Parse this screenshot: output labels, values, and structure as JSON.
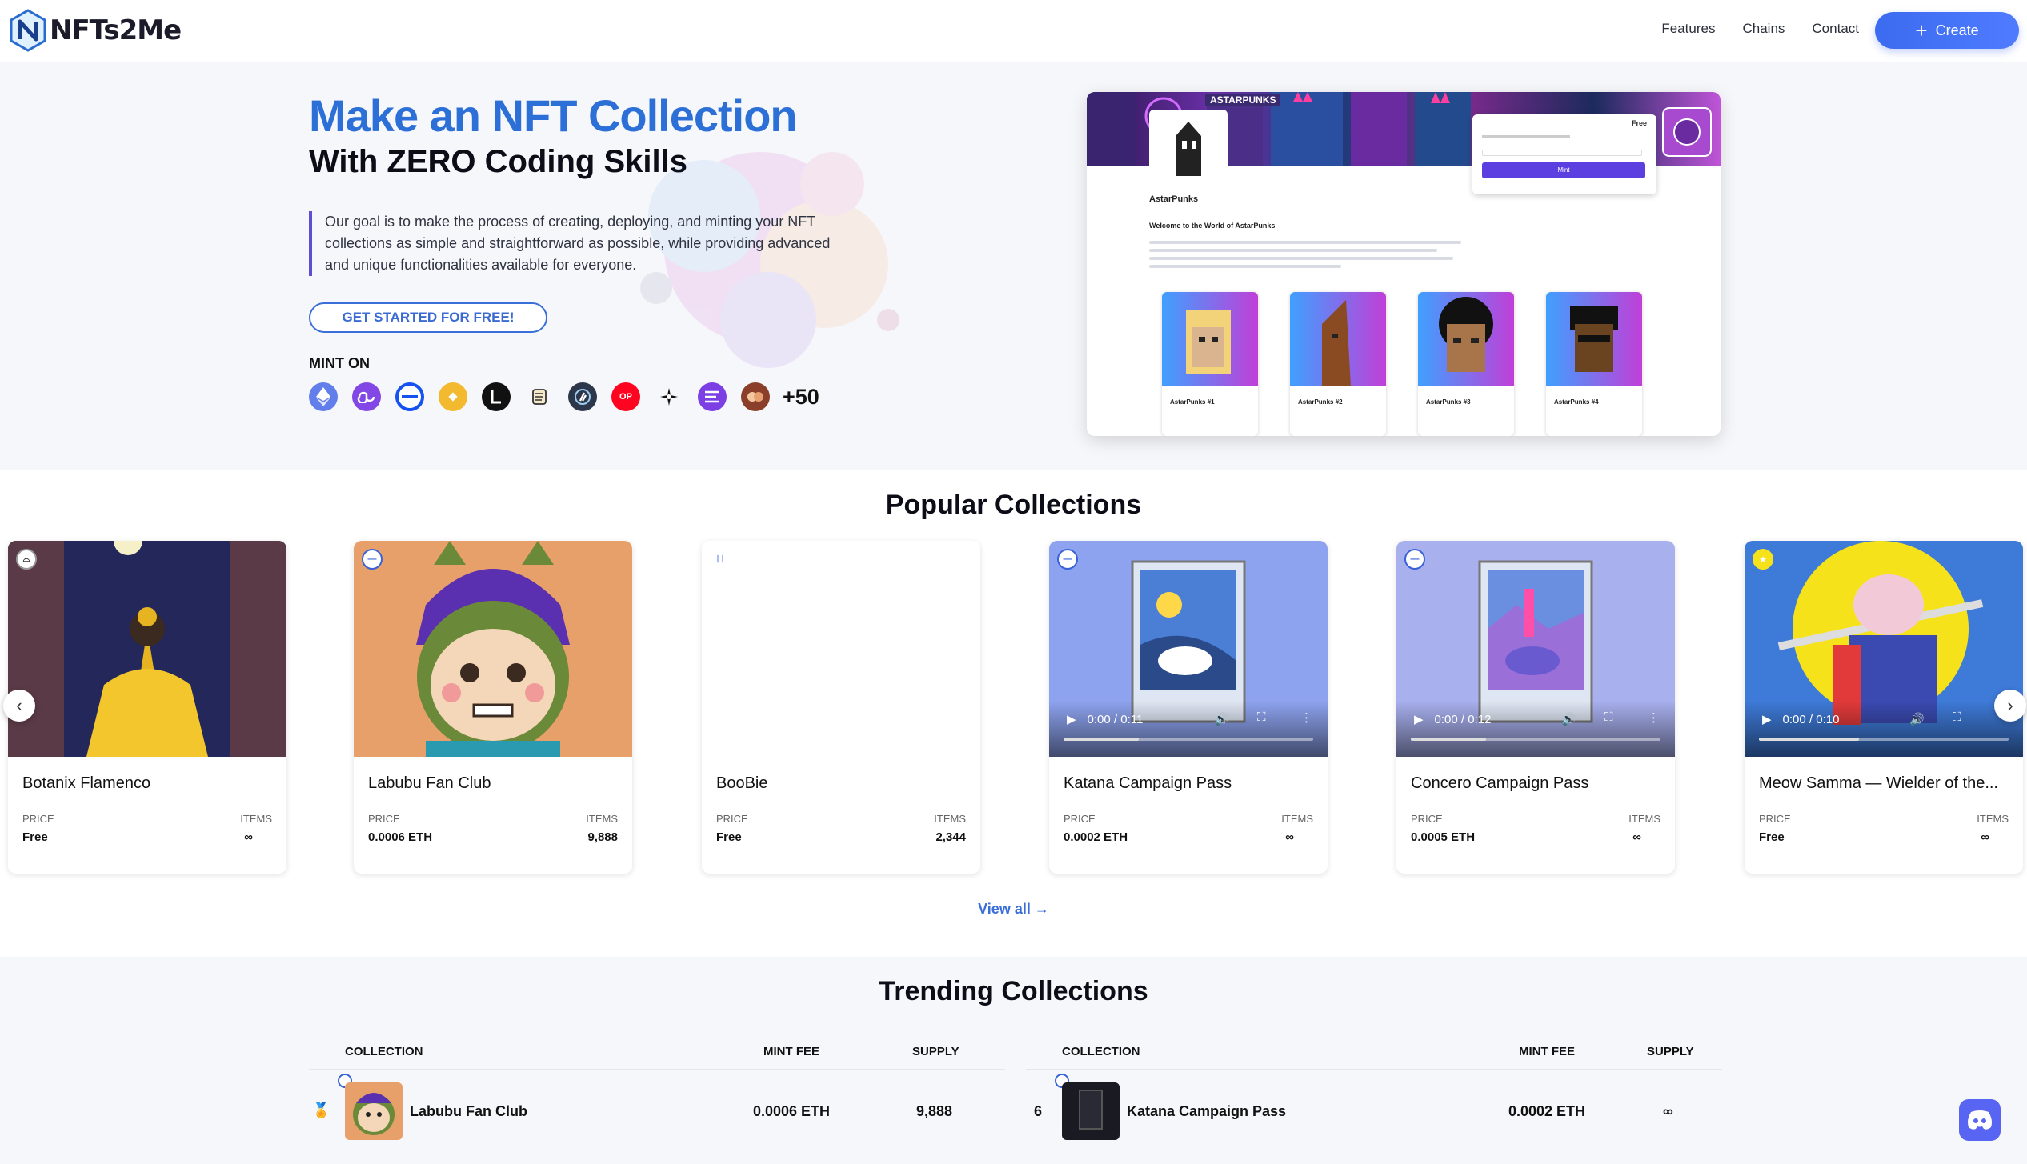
{
  "brand": {
    "name": "NFTs2Me"
  },
  "nav": {
    "links": [
      "Features",
      "Chains",
      "Contact"
    ],
    "create_label": "Create"
  },
  "hero": {
    "title": "Make an NFT Collection",
    "subtitle": "With ZERO Coding Skills",
    "description": "Our goal is to make the process of creating, deploying, and minting your NFT collections as simple and straightforward as possible, while providing advanced and unique functionalities available for everyone.",
    "cta_label": "GET STARTED FOR FREE!",
    "mint_on_label": "MINT ON",
    "chains": [
      {
        "icon": "ethereum-icon",
        "color": "#627eea"
      },
      {
        "icon": "polygon-icon",
        "color": "#8247e5"
      },
      {
        "icon": "base-icon",
        "color": "#1652f0"
      },
      {
        "icon": "bnb-icon",
        "color": "#f3ba2f"
      },
      {
        "icon": "linea-icon",
        "color": "#111111"
      },
      {
        "icon": "scroll-icon",
        "color": "#f5e8c8"
      },
      {
        "icon": "arbitrum-icon",
        "color": "#2d374b"
      },
      {
        "icon": "optimism-icon",
        "color": "#ff0420"
      },
      {
        "icon": "astar-icon",
        "color": "#ffffff"
      },
      {
        "icon": "ethena-icon",
        "color": "#7b3fe4"
      },
      {
        "icon": "mantle-icon",
        "color": "#8b3f2a"
      }
    ],
    "chains_more": "+50",
    "optimism_text": "OP",
    "preview": {
      "name": "AstarPunks",
      "welcome": "Welcome to the World of AstarPunks",
      "banner_label": "ASTARPUNKS",
      "price_label": "Free",
      "mint_label": "Mint",
      "cards": [
        "AstarPunks #1",
        "AstarPunks #2",
        "AstarPunks #3",
        "AstarPunks #4"
      ]
    }
  },
  "popular": {
    "title": "Popular Collections",
    "price_label": "PRICE",
    "items_label": "ITEMS",
    "view_all": "View all",
    "collections": [
      {
        "name": "Botanix Flamenco",
        "price": "Free",
        "items": "∞"
      },
      {
        "name": "Labubu Fan Club",
        "price": "0.0006 ETH",
        "items": "9,888"
      },
      {
        "name": "BooBie",
        "price": "Free",
        "items": "2,344"
      },
      {
        "name": "Katana Campaign Pass",
        "price": "0.0002 ETH",
        "items": "∞",
        "video_time": "0:00 / 0:11"
      },
      {
        "name": "Concero Campaign Pass",
        "price": "0.0005 ETH",
        "items": "∞",
        "video_time": "0:00 / 0:12"
      },
      {
        "name": "Meow Samma — Wielder of the...",
        "price": "Free",
        "items": "∞",
        "video_time": "0:00 / 0:10"
      }
    ]
  },
  "trending": {
    "title": "Trending Collections",
    "headers": {
      "collection": "COLLECTION",
      "mint_fee": "MINT FEE",
      "supply": "SUPPLY"
    },
    "rows": [
      {
        "rank": "",
        "name": "Labubu Fan Club",
        "mint_fee": "0.0006 ETH",
        "supply": "9,888"
      },
      {
        "rank": "6",
        "name": "Katana Campaign Pass",
        "mint_fee": "0.0002 ETH",
        "supply": "∞"
      }
    ]
  }
}
